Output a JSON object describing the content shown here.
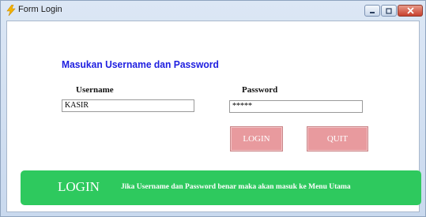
{
  "window": {
    "title": "Form Login",
    "icon": "lightning-icon",
    "controls": [
      "minimize-icon",
      "maximize-icon",
      "close-icon"
    ]
  },
  "form": {
    "heading": "Masukan Username dan Password",
    "username_label": "Username",
    "username_value": "KASIR",
    "password_label": "Password",
    "password_value": "*****",
    "login_button": "LOGIN",
    "quit_button": "QUIT"
  },
  "banner": {
    "title": "LOGIN",
    "text": "Jika Username dan Password benar maka akan masuk ke Menu Utama"
  },
  "colors": {
    "heading": "#2020e0",
    "button_bg": "#e89a9e",
    "banner_bg": "#2ec95e"
  }
}
